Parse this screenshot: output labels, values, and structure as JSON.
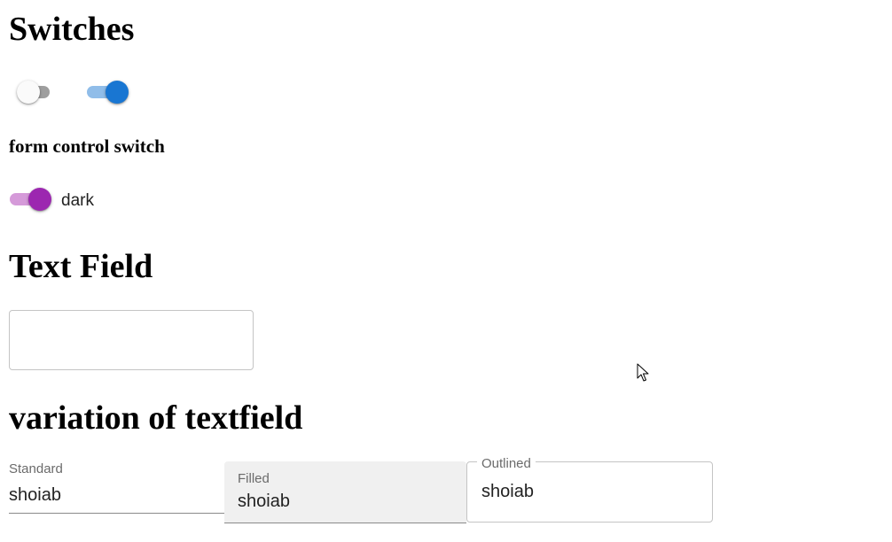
{
  "sections": {
    "switches_title": "Switches",
    "form_control_title": "form control switch",
    "text_field_title": "Text Field",
    "variation_title": "variation of textfield"
  },
  "switches": [
    {
      "checked": false,
      "color": "#9e9e9e"
    },
    {
      "checked": true,
      "color": "#1976d2"
    }
  ],
  "form_control_switch": {
    "checked": true,
    "color": "#9c27b0",
    "label": "dark"
  },
  "text_field": {
    "value": ""
  },
  "textfield_variations": {
    "standard": {
      "label": "Standard",
      "value": "shoiab"
    },
    "filled": {
      "label": "Filled",
      "value": "shoiab"
    },
    "outlined": {
      "label": "Outlined",
      "value": "shoiab"
    }
  },
  "colors": {
    "primary": "#1976d2",
    "secondary": "#9c27b0",
    "switch_off_track": "#9e9e9e"
  }
}
